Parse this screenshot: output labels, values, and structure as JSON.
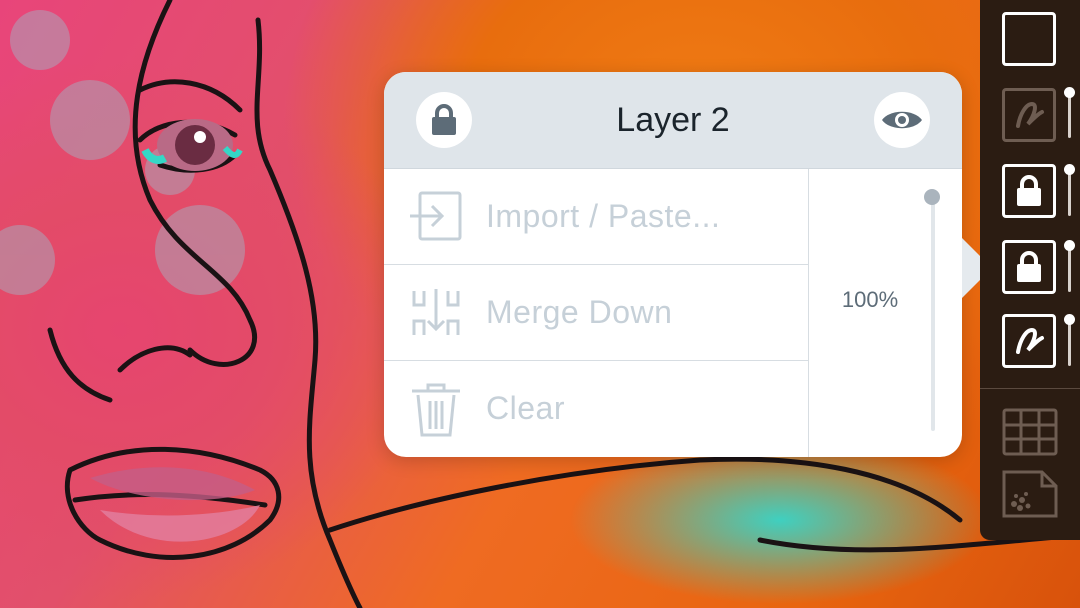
{
  "layer_popover": {
    "title": "Layer 2",
    "lock_icon": "lock-icon",
    "visibility_icon": "eye-icon",
    "menu": [
      {
        "label": "Import / Paste...",
        "icon": "import-icon"
      },
      {
        "label": "Merge Down",
        "icon": "merge-down-icon"
      },
      {
        "label": "Clear",
        "icon": "trash-icon"
      }
    ],
    "opacity_label": "100%",
    "opacity": 1.0
  },
  "layer_strip": {
    "layers": [
      {
        "name": "empty-layer",
        "icon": "blank-layer-icon",
        "selected": false
      },
      {
        "name": "sketch-layer",
        "icon": "brush-stroke-icon",
        "dimmed": true
      },
      {
        "name": "locked-layer",
        "icon": "lock-icon",
        "selected": false
      },
      {
        "name": "layer-2",
        "icon": "lock-icon",
        "selected": true
      },
      {
        "name": "ink-layer",
        "icon": "brush-stroke-icon",
        "selected": false
      }
    ],
    "tools": [
      "grid-icon",
      "paper-texture-icon"
    ]
  },
  "colors": {
    "popover_header": "#dfe5ea",
    "disabled_text": "#c6d0d8",
    "strip_bg": "#2b1c12",
    "canvas_orange": "#ef6b22",
    "canvas_pink": "#e34b68"
  }
}
